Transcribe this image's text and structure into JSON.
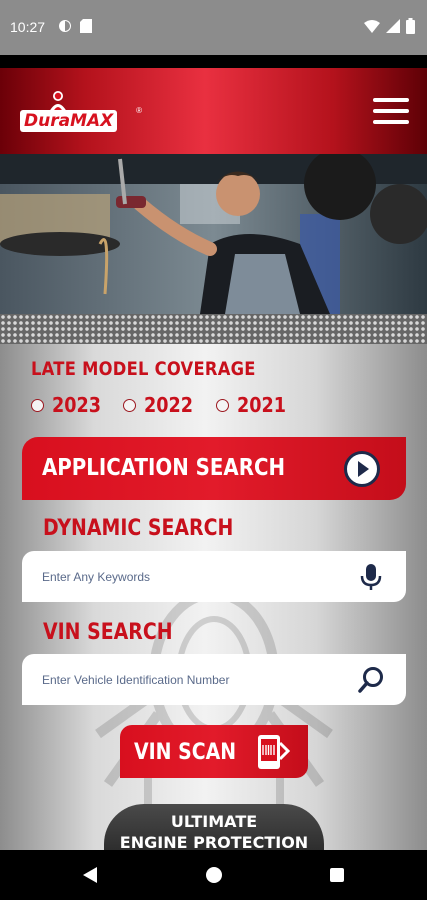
{
  "status_bar": {
    "time": "10:27",
    "left_icons": [
      "data-saver-icon",
      "sim-card-icon"
    ],
    "right_icons": [
      "wifi-icon",
      "signal-icon",
      "battery-icon"
    ]
  },
  "header": {
    "logo_text_dura": "Dura",
    "logo_text_max": "MAX",
    "logo_mark": "®",
    "menu_icon": "hamburger-menu-icon",
    "brand_color": "#d7121f"
  },
  "hero": {
    "description_icon": "mechanic-photo"
  },
  "late_model": {
    "title": "LATE MODEL COVERAGE",
    "years": [
      "2023",
      "2022",
      "2021"
    ],
    "selected": null
  },
  "application_search": {
    "label": "APPLICATION SEARCH",
    "icon": "play-circle-icon"
  },
  "dynamic_search": {
    "title": "DYNAMIC SEARCH",
    "placeholder": "Enter Any Keywords",
    "value": "",
    "icon": "microphone-icon"
  },
  "vin_search": {
    "title": "VIN SEARCH",
    "placeholder": "Enter Vehicle Identification Number",
    "value": "",
    "icon": "search-icon"
  },
  "vin_scan": {
    "label": "VIN SCAN",
    "icon": "barcode-scan-icon"
  },
  "engine_banner": {
    "line1": "ULTIMATE",
    "line2": "ENGINE PROTECTION"
  },
  "nav_bar": {
    "icons": [
      "back-icon",
      "home-icon",
      "recents-icon"
    ]
  },
  "colors": {
    "accent_red": "#c8101c",
    "navy": "#1e2a4a"
  }
}
